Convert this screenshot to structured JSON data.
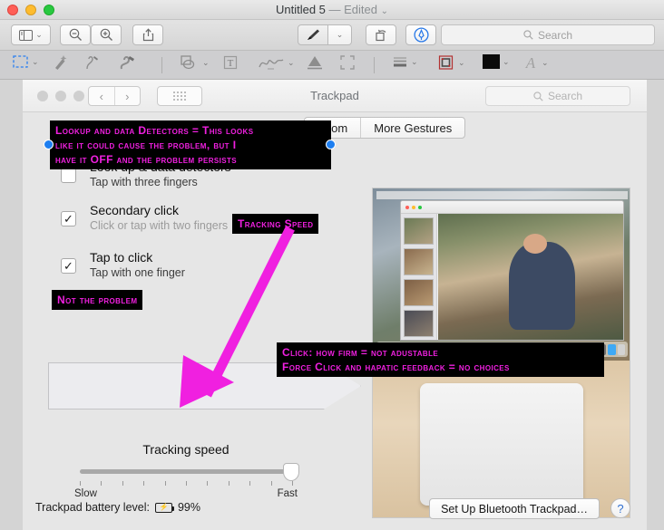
{
  "window": {
    "title": "Untitled 5",
    "separator": "—",
    "edited": "Edited",
    "chevron": "⌄"
  },
  "toolbar": {
    "sidebar_icon": "sidebar-icon",
    "zoom_out_icon": "zoom-out-icon",
    "zoom_in_icon": "zoom-in-icon",
    "share_icon": "share-icon",
    "markup_icon": "markup-pen-icon",
    "rotate_icon": "rotate-icon",
    "annotate_icon": "annotate-icon",
    "search_placeholder": "Search",
    "caret": "⌄"
  },
  "markup_bar": {
    "selection_icon": "rectangular-selection-icon",
    "instant_alpha_icon": "instant-alpha-icon",
    "sketch_icon": "sketch-icon",
    "draw_icon": "draw-icon",
    "shapes_icon": "shapes-icon",
    "text_icon": "text-box-icon",
    "sign_icon": "signature-icon",
    "highlight_icon": "highlight-icon",
    "crop_icon": "crop-icon",
    "shape_style_icon": "shape-style-icon",
    "border_color_icon": "border-color-icon",
    "fill_color_icon": "fill-color-icon",
    "text_style_icon": "text-style-icon",
    "caret": "⌄"
  },
  "prefs_window": {
    "title": "Trackpad",
    "back_icon": "‹",
    "forward_icon": "›",
    "grid_icon": "show-all-icon",
    "search_placeholder": "Search"
  },
  "tabs": [
    {
      "label": "Zoom"
    },
    {
      "label": "More Gestures"
    }
  ],
  "options": [
    {
      "title": "Look up & data detectors",
      "subtitle": "Tap with three fingers",
      "checked": false,
      "check_glyph": "",
      "has_dropdown": false
    },
    {
      "title": "Secondary click",
      "subtitle": "Click or tap with two fingers",
      "checked": true,
      "check_glyph": "✓",
      "has_dropdown": true,
      "dropdown_glyph": "⌄"
    },
    {
      "title": "Tap to click",
      "subtitle": "Tap with one finger",
      "checked": true,
      "check_glyph": "✓",
      "has_dropdown": false
    }
  ],
  "slider": {
    "label": "Tracking speed",
    "min_label": "Slow",
    "max_label": "Fast",
    "value_percent": 100
  },
  "status_bar": {
    "battery_label": "Trackpad battery level:",
    "battery_icon": "battery-charging-icon",
    "battery_glyph": "⚡",
    "battery_value": "99%",
    "setup_button": "Set Up Bluetooth Trackpad…",
    "help_button": "?"
  },
  "annotations": [
    {
      "id": "lookup-note",
      "lines": "Lookup and data Detectors = This looks\nlike it could cause the problem, but I\nhave it OFF and the problem persists"
    },
    {
      "id": "tracking-speed-note",
      "lines": "Tracking Speed"
    },
    {
      "id": "not-the-problem-note",
      "lines": "Not the problem"
    },
    {
      "id": "click-firmness-note",
      "lines": "Click: how firm = not adustable\nForce Click and hapatic feedback = no choices"
    }
  ],
  "colors": {
    "annotation_text": "#f020e0",
    "annotation_bg": "#000000",
    "arrow": "#f020e0",
    "selection_handle": "#1d7ef0",
    "help_blue": "#2f6fd0"
  }
}
